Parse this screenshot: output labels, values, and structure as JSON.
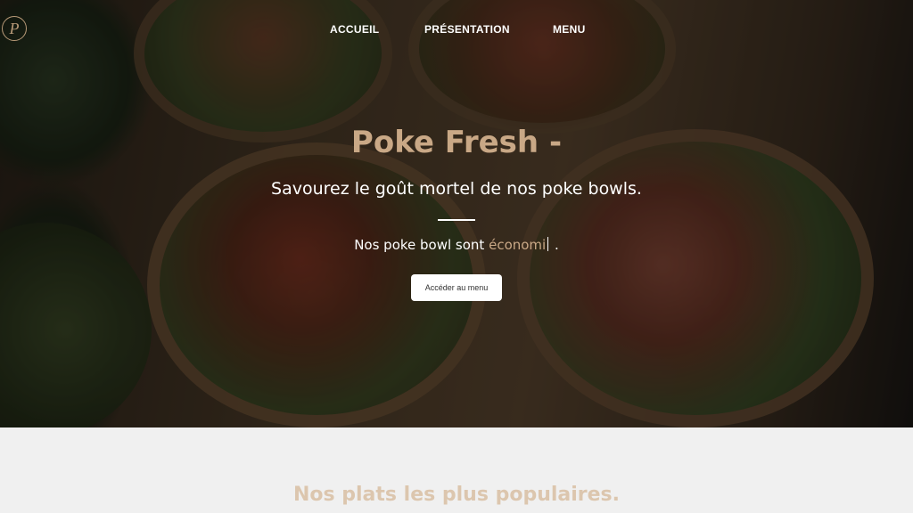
{
  "brand": {
    "logo_letter": "P"
  },
  "nav": {
    "items": [
      {
        "label": "ACCUEIL"
      },
      {
        "label": "PRÉSENTATION"
      },
      {
        "label": "MENU"
      }
    ]
  },
  "hero": {
    "title": "Poke Fresh -",
    "subtitle": "Savourez le goût mortel de nos poke bowls.",
    "tagline_prefix": "Nos poke bowl sont ",
    "tagline_typed": "économi",
    "tagline_suffix": ".",
    "cta_label": "Accéder au menu"
  },
  "popular": {
    "title": "Nos plats les plus populaires."
  },
  "colors": {
    "accent": "#c9a886",
    "section_bg": "#f0f0f0",
    "section_title": "#dcc6ae"
  }
}
